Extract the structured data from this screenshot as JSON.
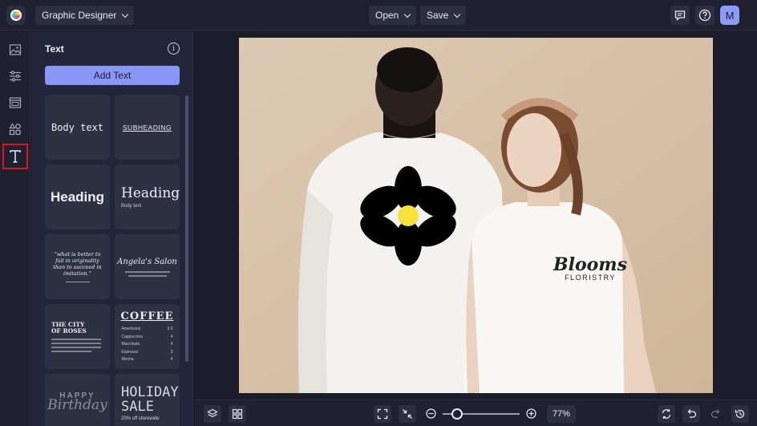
{
  "topbar": {
    "project_label": "Graphic Designer",
    "open_label": "Open",
    "save_label": "Save",
    "avatar_initial": "M"
  },
  "panel": {
    "title": "Text",
    "add_text_label": "Add Text",
    "tiles": {
      "body": "Body text",
      "subheading": "SUBHEADING",
      "heading_sans": "Heading",
      "heading_serif": "Heading",
      "heading_serif_sub": "Body text",
      "quote": "“what is better to fail in originality than to succeed in imitation.”",
      "salon": "Angela's Salon",
      "city_title": "THE CITY OF ROSES",
      "coffee_title": "COFFEE",
      "coffee_items": [
        {
          "name": "Americano",
          "price": "3.5"
        },
        {
          "name": "Cappuccino",
          "price": "4"
        },
        {
          "name": "Macchiato",
          "price": "4"
        },
        {
          "name": "Espresso",
          "price": "3"
        },
        {
          "name": "Mocha",
          "price": "4"
        }
      ],
      "birthday_top": "HAPPY",
      "birthday_bottom": "Birthday",
      "holiday_line1": "HOLIDAY",
      "holiday_line2": "SALE",
      "holiday_line3": "20% off storewide"
    }
  },
  "canvas": {
    "shirt_logo_line1": "Blooms",
    "shirt_logo_line2": "FLORISTRY"
  },
  "bottombar": {
    "zoom_value": "77%",
    "zoom_level_fraction": 0.2
  }
}
